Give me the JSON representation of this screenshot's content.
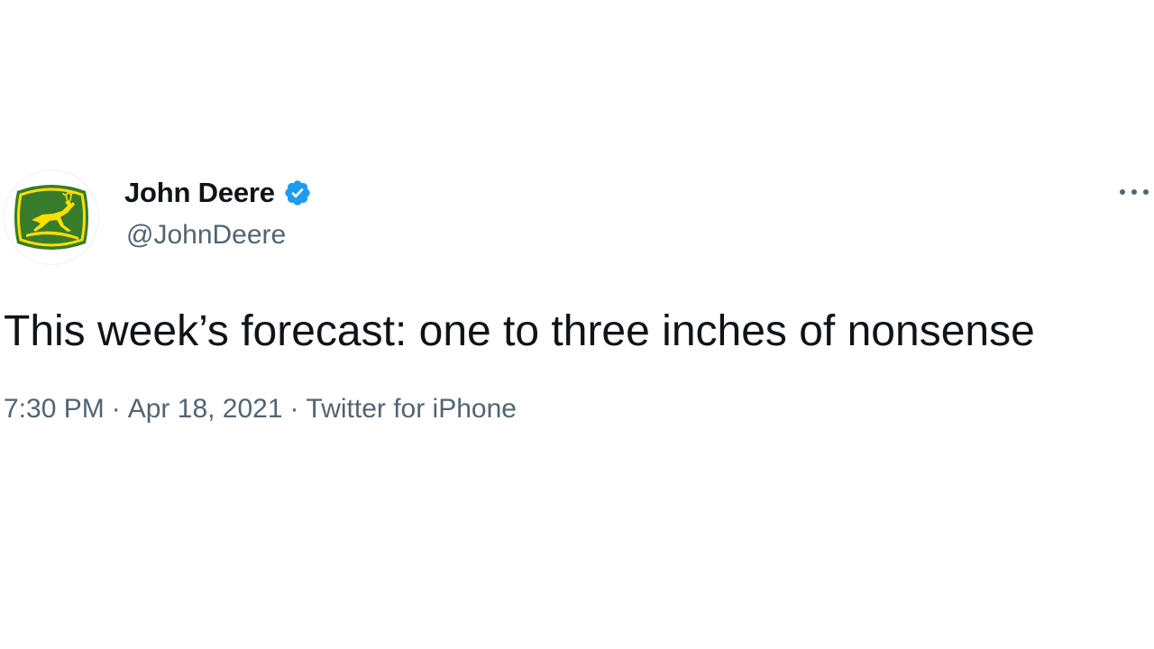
{
  "author": {
    "display_name": "John Deere",
    "handle": "@JohnDeere",
    "verified": true,
    "avatar_icon": "john-deere-leaping-deer-logo",
    "logo_colors": {
      "green": "#367C2B",
      "yellow": "#FFDE00"
    }
  },
  "tweet": {
    "text": "This week’s forecast: one to three inches of nonsense"
  },
  "meta": {
    "time": "7:30 PM",
    "separator": "·",
    "date": "Apr 18, 2021",
    "source": "Twitter for iPhone"
  },
  "icons": {
    "verified": "verified-badge-icon",
    "more": "more-options-icon"
  },
  "colors": {
    "text_primary": "#0f1419",
    "text_secondary": "#536471",
    "verified_blue": "#1d9bf0"
  }
}
